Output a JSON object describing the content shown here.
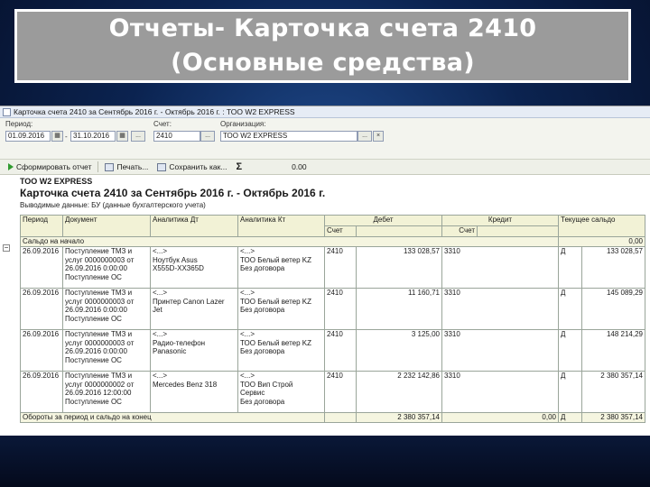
{
  "slide": {
    "title": "Отчеты- Карточка счета 2410 (Основные средства)"
  },
  "window": {
    "title": "Карточка счета 2410 за Сентябрь 2016 г. - Октябрь 2016 г. : ТОО W2 EXPRESS"
  },
  "params": {
    "period_label": "Период:",
    "date_from": "01.09.2016",
    "date_to": "31.10.2016",
    "ellipsis": "...",
    "account_label": "Счет:",
    "account": "2410",
    "org_label": "Организация:",
    "org": "ТОО W2 EXPRESS",
    "clear": "×"
  },
  "toolbar": {
    "generate": "Сформировать отчет",
    "print": "Печать...",
    "save": "Сохранить как...",
    "sum_value": "0.00"
  },
  "report": {
    "org": "ТОО W2 EXPRESS",
    "title": "Карточка счета 2410 за Сентябрь 2016 г. - Октябрь 2016 г.",
    "source": "Выводимые данные: БУ (данные бухгалтерского учета)"
  },
  "table": {
    "headers": {
      "period": "Период",
      "document": "Документ",
      "an_dt": "Аналитика Дт",
      "an_kt": "Аналитика Кт",
      "debit": "Дебет",
      "credit": "Кредит",
      "balance": "Текущее сальдо",
      "account": "Счет",
      "account2": "Счет"
    },
    "opening": {
      "label": "Сальдо на начало",
      "value": "0,00"
    },
    "rows": [
      {
        "date": "26.09.2016",
        "doc": [
          "Поступление ТМЗ и",
          "услуг 0000000003 от",
          "26.09.2016 0:00:00",
          "Поступление ОС"
        ],
        "an_dt": [
          "<...>",
          "Ноутбук Asus",
          "X555D-XX365D"
        ],
        "an_kt": [
          "<...>",
          "ТОО Белый ветер KZ",
          "Без договора"
        ],
        "dt_acc": "2410",
        "amount": "133 028,57",
        "kt_acc": "3310",
        "side": "Д",
        "balance": "133 028,57"
      },
      {
        "date": "26.09.2016",
        "doc": [
          "Поступление ТМЗ и",
          "услуг 0000000003 от",
          "26.09.2016 0:00:00",
          "Поступление ОС"
        ],
        "an_dt": [
          "<...>",
          "Принтер Canon Lazer",
          "Jet"
        ],
        "an_kt": [
          "<...>",
          "ТОО Белый ветер KZ",
          "Без договора"
        ],
        "dt_acc": "2410",
        "amount": "11 160,71",
        "kt_acc": "3310",
        "side": "Д",
        "balance": "145 089,29"
      },
      {
        "date": "26.09.2016",
        "doc": [
          "Поступление ТМЗ и",
          "услуг 0000000003 от",
          "26.09.2016 0:00:00",
          "Поступление ОС"
        ],
        "an_dt": [
          "<...>",
          "Радио-телефон",
          "Panasonic"
        ],
        "an_kt": [
          "<...>",
          "ТОО Белый ветер KZ",
          "Без договора"
        ],
        "dt_acc": "2410",
        "amount": "3 125,00",
        "kt_acc": "3310",
        "side": "Д",
        "balance": "148 214,29"
      },
      {
        "date": "26.09.2016",
        "doc": [
          "Поступление ТМЗ и",
          "услуг 0000000002 от",
          "26.09.2016 12:00:00",
          "Поступление ОС"
        ],
        "an_dt": [
          "<...>",
          "Mercedes Benz 318"
        ],
        "an_kt": [
          "<...>",
          "ТОО Вип Строй",
          "Сервис",
          "Без договора"
        ],
        "dt_acc": "2410",
        "amount": "2 232 142,86",
        "kt_acc": "3310",
        "side": "Д",
        "balance": "2 380 357,14"
      }
    ],
    "totals": {
      "label": "Обороты за период и сальдо на конец",
      "debit": "2 380 357,14",
      "credit": "0,00",
      "side": "Д",
      "balance": "2 380 357,14"
    }
  }
}
